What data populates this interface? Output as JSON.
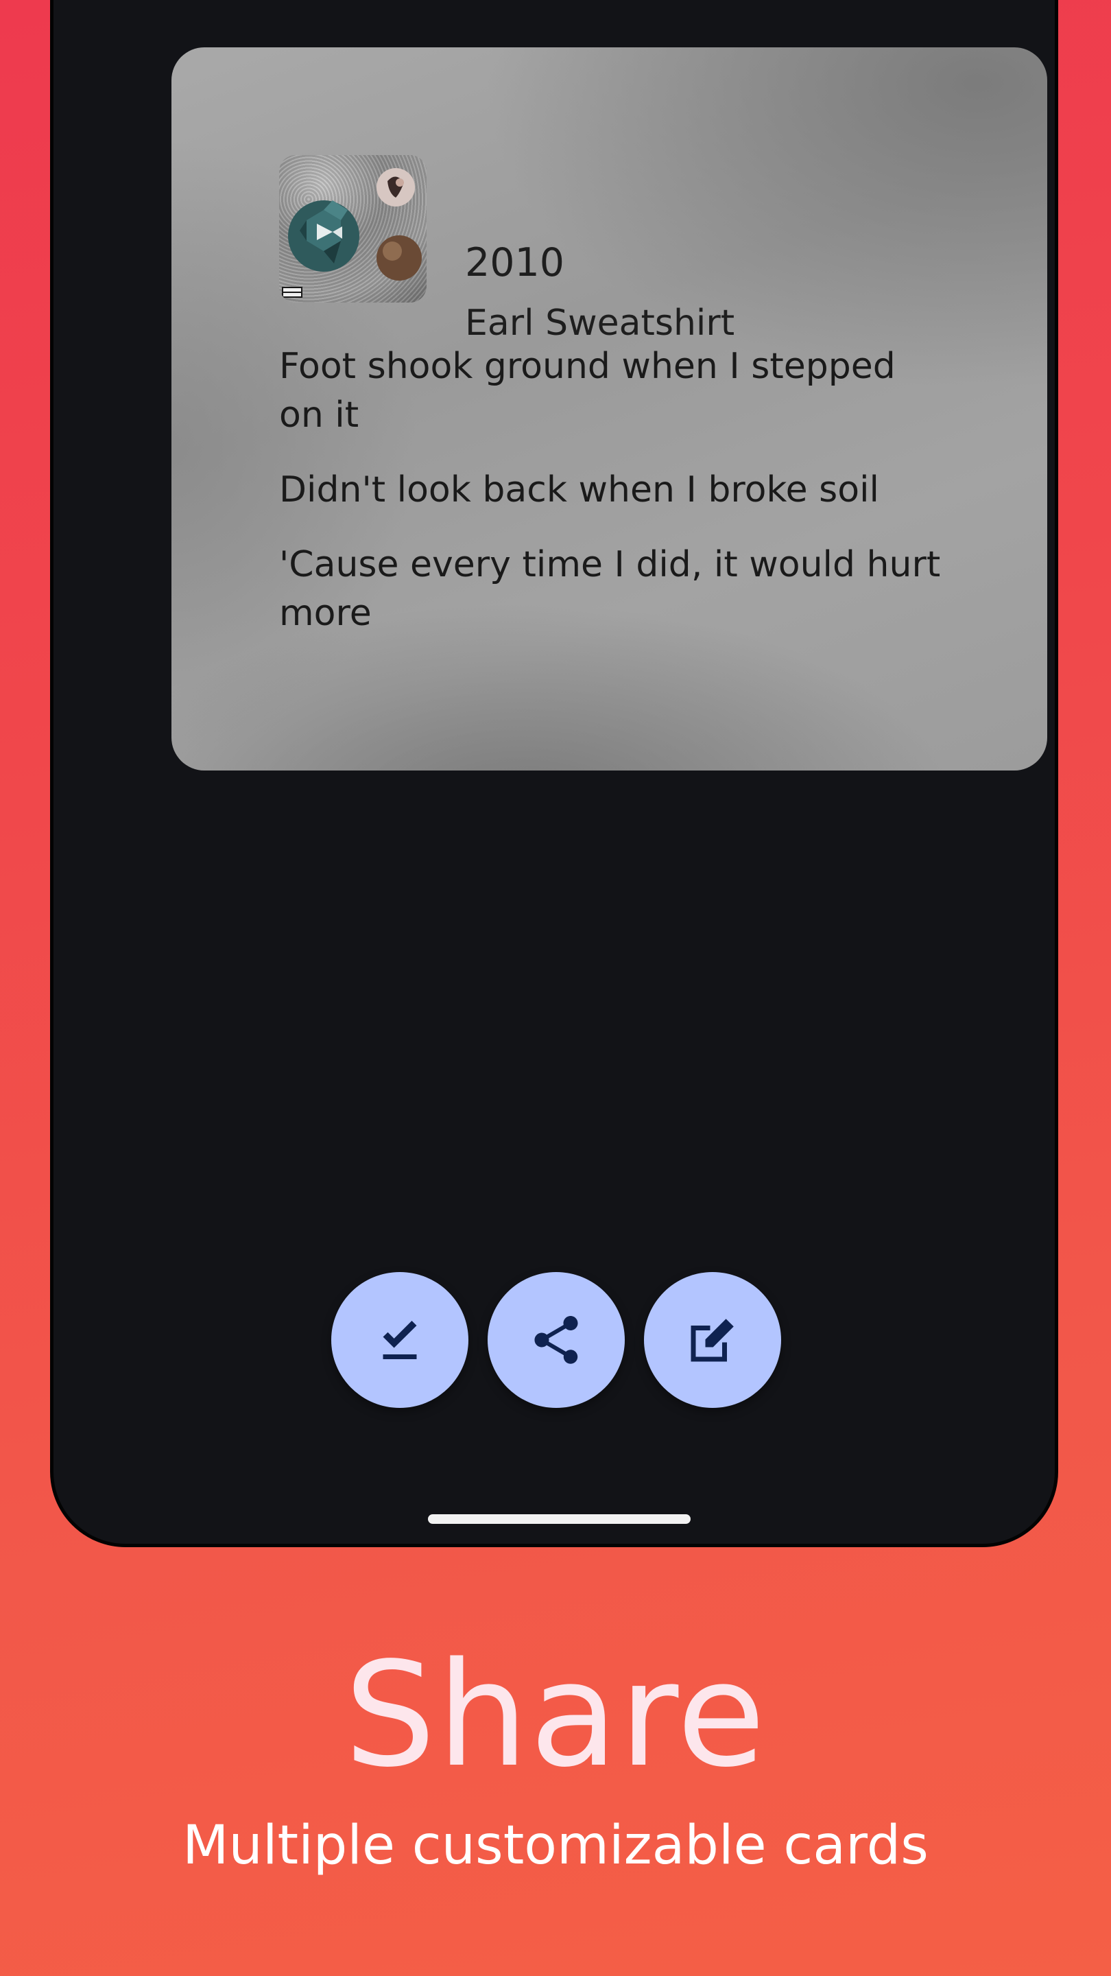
{
  "card": {
    "track_title": "2010",
    "artist": "Earl Sweatshirt",
    "lyrics": [
      "Foot shook ground when I stepped on it",
      "Didn't look back when I broke soil",
      "'Cause every time I did, it would hurt more"
    ]
  },
  "actions": [
    {
      "icon": "download-done-icon"
    },
    {
      "icon": "share-icon"
    },
    {
      "icon": "edit-icon"
    }
  ],
  "footer": {
    "headline": "Share",
    "subline": "Multiple customizable cards"
  },
  "colors": {
    "background_top": "#ee3a4e",
    "background_bottom": "#f45f46",
    "phone_screen": "#121317",
    "fab": "#b3c5ff",
    "fab_icon": "#0f2250",
    "headline": "#fde6ec"
  }
}
